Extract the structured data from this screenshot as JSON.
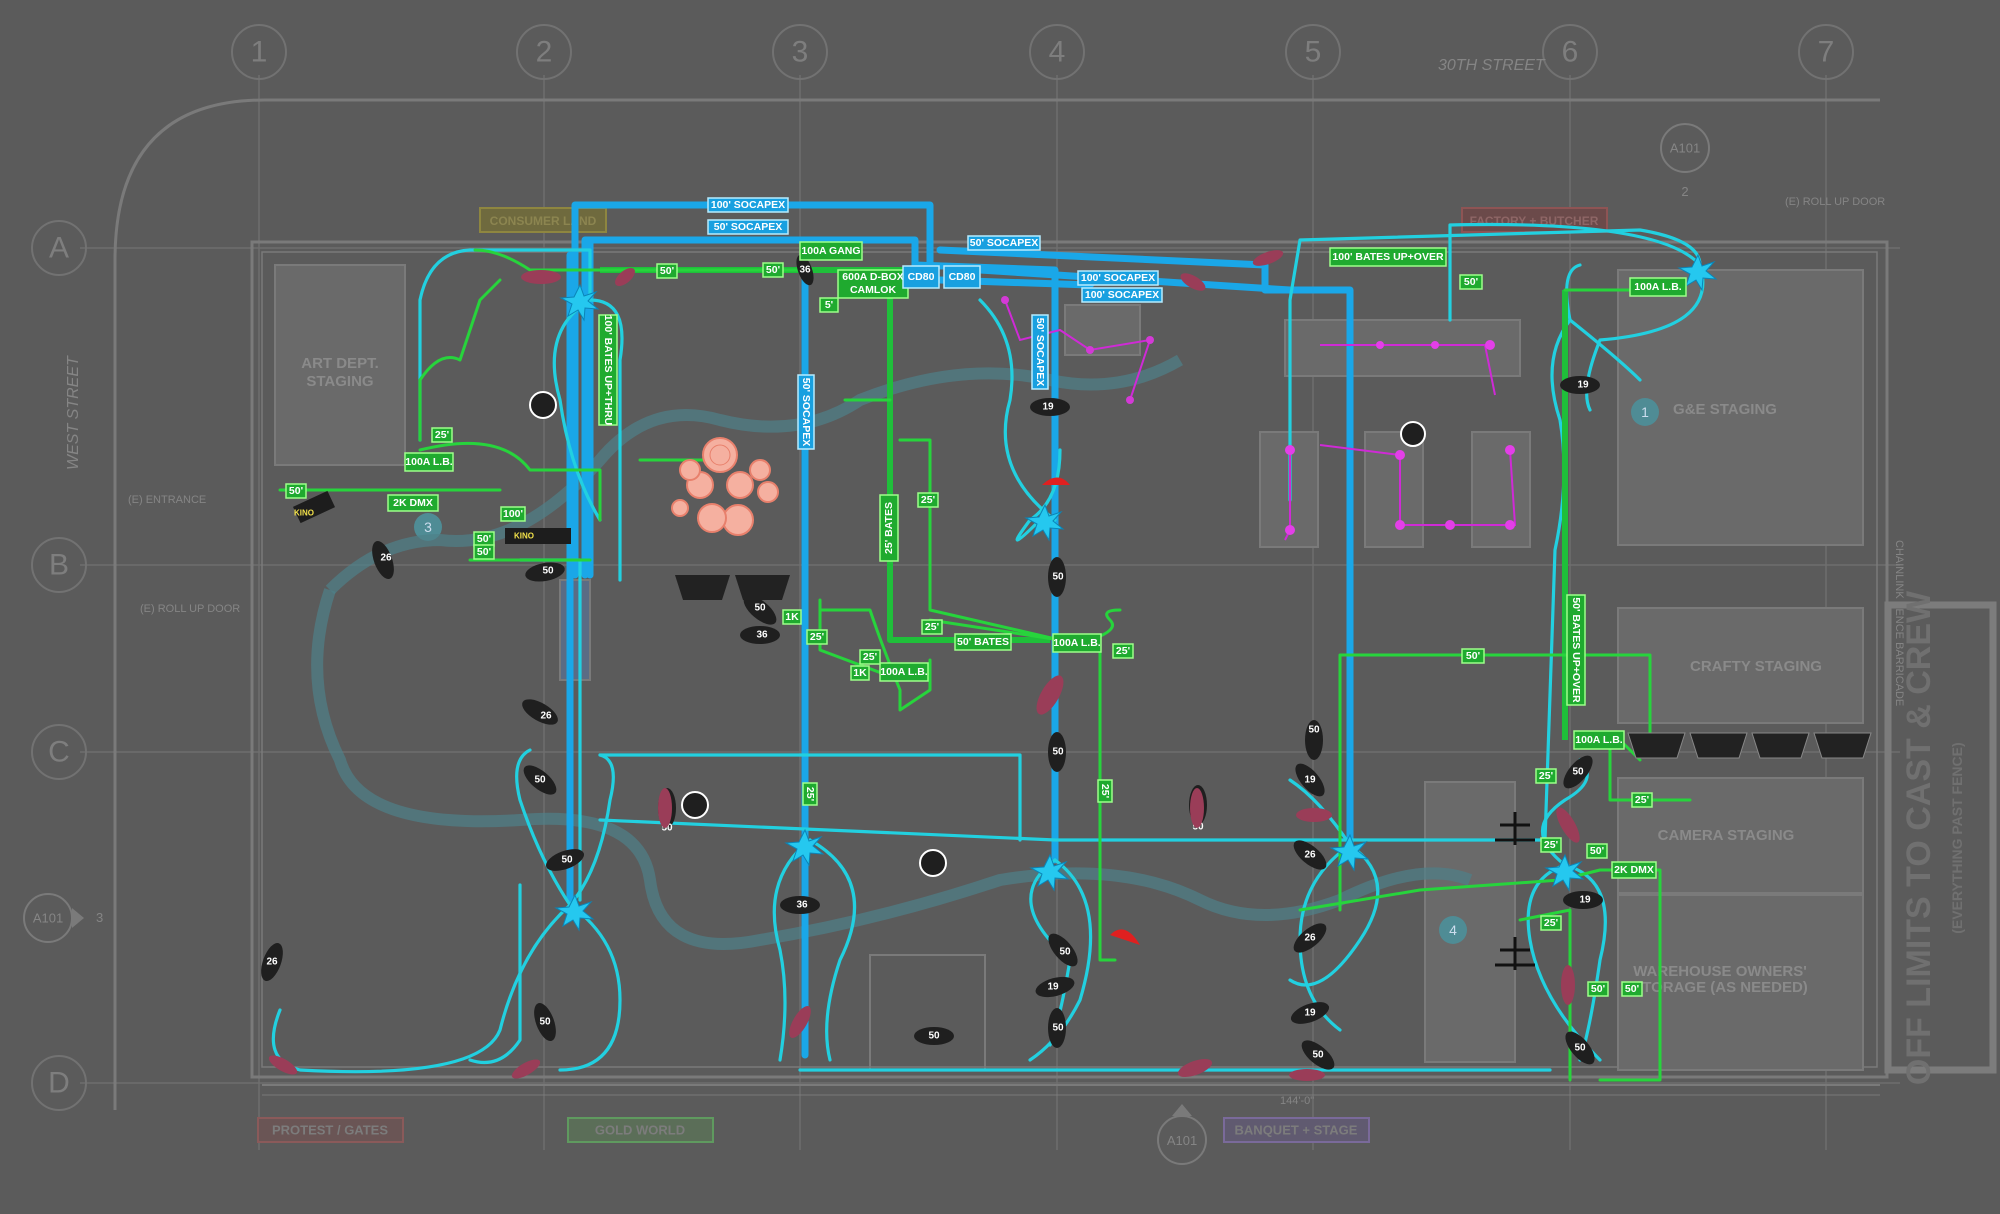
{
  "grid": {
    "columns": [
      "1",
      "2",
      "3",
      "4",
      "5",
      "6",
      "7"
    ],
    "rows": [
      "A",
      "B",
      "C",
      "D"
    ]
  },
  "streets": {
    "north": "30TH STREET",
    "west": "WEST STREET"
  },
  "notes": {
    "entrance": "(E) ENTRANCE",
    "roll_up_west": "(E) ROLL UP DOOR",
    "roll_up_north": "(E) ROLL UP DOOR",
    "chainlink": "CHAINLINK FENCE BARRICADE",
    "dimension": "144'-0\""
  },
  "section_refs": {
    "north": {
      "sheet": "A101",
      "num": "2"
    },
    "west": {
      "sheet": "A101",
      "num": "3"
    },
    "south": {
      "sheet": "A101",
      "num": ""
    }
  },
  "areas": {
    "art_dept": [
      "ART DEPT.",
      "STAGING"
    ],
    "consumer": "CONSUMER LAND",
    "factory": "FACTORY + BUTCHER",
    "ge": "G&E STAGING",
    "crafty": "CRAFTY STAGING",
    "camera": "CAMERA STAGING",
    "warehouse": [
      "WAREHOUSE OWNERS'",
      "STORAGE (AS NEEDED)"
    ],
    "protest": "PROTEST / GATES",
    "gold": "GOLD WORLD",
    "banquet": "BANQUET + STAGE"
  },
  "zone_numbers": [
    "1",
    "3",
    "4"
  ],
  "off_limits": {
    "main": "OFF LIMITS TO CAST & CREW",
    "sub": "(EVERYTHING PAST FENCE)"
  },
  "cable_labels_blue": {
    "b1": "100' SOCAPEX",
    "b2": "50' SOCAPEX",
    "b3": "50' SOCAPEX",
    "b4": "100' SOCAPEX",
    "b5": "100' SOCAPEX",
    "b6": "50' SOCAPEX",
    "b7": "50' SOCAPEX",
    "cd1": "CD80",
    "cd2": "CD80"
  },
  "cable_labels_green": {
    "gang": "100A GANG",
    "dbox1": "600A D-BOX",
    "dbox2": "CAMLOK",
    "lb1": "100A L.B.",
    "lb2": "100A L.B.",
    "lb3": "100A L.B.",
    "lb4": "100A L.B.",
    "lb5": "100A L.B.",
    "bates_upthru": "100' BATES UP+THRU",
    "bates_upover": "100' BATES UP+OVER",
    "bates_upover50": "50' BATES UP+OVER",
    "bates25": "25' BATES",
    "bates50": "50' BATES",
    "dmx1": "2K DMX",
    "dmx2": "2K DMX",
    "l50": "50'",
    "l25": "25'",
    "l100": "100'",
    "l5": "5'",
    "k1": "1K"
  },
  "fixtures": {
    "f50": "50",
    "f36": "36",
    "f26": "26",
    "f19": "19",
    "kino": "KINO"
  }
}
